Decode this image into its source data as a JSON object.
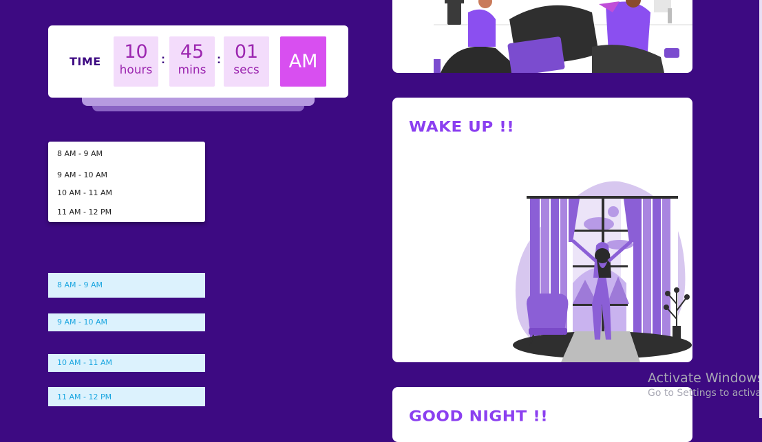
{
  "clock": {
    "label": "TIME",
    "hours_value": "10",
    "hours_unit": "hours",
    "mins_value": "45",
    "mins_unit": "mins",
    "secs_value": "01",
    "secs_unit": "secs",
    "separator": ":",
    "period": "AM"
  },
  "dropdown": {
    "items": [
      "8 AM - 9 AM",
      "9 AM - 10 AM",
      "10 AM - 11 AM",
      "11 AM - 12 PM"
    ]
  },
  "slots": [
    "8 AM - 9 AM",
    "9 AM - 10 AM",
    "10 AM - 11 AM",
    "11 AM - 12 PM"
  ],
  "cards": {
    "wake_title": "WAKE UP !!",
    "night_title": "GOOD NIGHT !!"
  },
  "watermark": {
    "title": "Activate Windows",
    "subtitle": "Go to Settings to activate"
  },
  "colors": {
    "background": "#3d0a82",
    "accent": "#d84ff0",
    "box": "#f3dcfb",
    "slot": "#dcf2fd",
    "title": "#8b3ff0"
  }
}
